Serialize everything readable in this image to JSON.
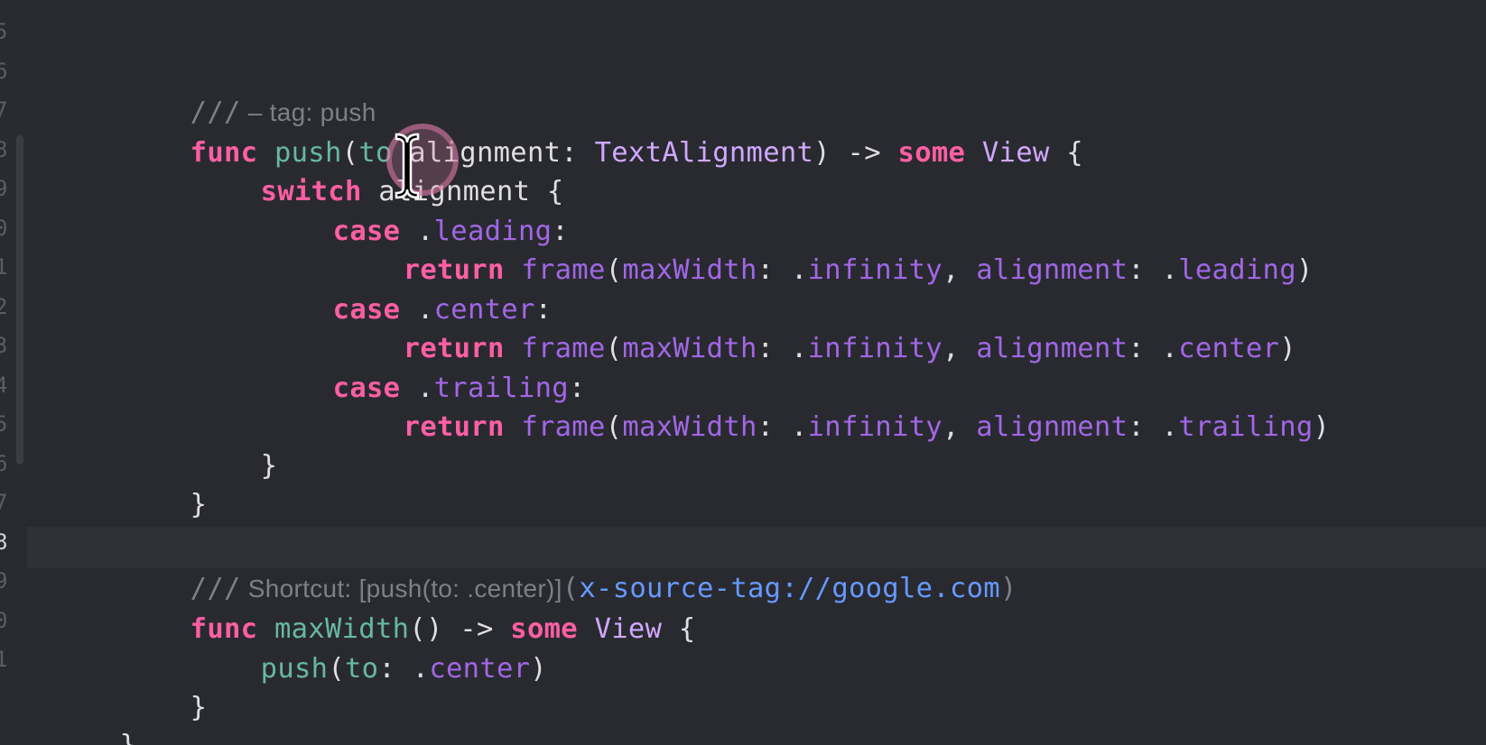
{
  "gutter": {
    "numbers": [
      "5",
      "6",
      "7",
      "8",
      "9",
      "0",
      "1",
      "2",
      "3",
      "4",
      "5",
      "6",
      "7",
      "8",
      "9",
      "0",
      "1"
    ],
    "current_index": 13
  },
  "code": {
    "line1": {
      "comment_slashes": "///",
      "comment_text": " – tag: push"
    },
    "line2": {
      "kw_func": "func",
      "name": "push",
      "open": "(",
      "label_to": "to",
      "param": " alignment: ",
      "type": "TextAlignment",
      "close": ") -> ",
      "kw_some": "some",
      "view": "View",
      "brace": " {"
    },
    "line3": {
      "kw_switch": "switch",
      "subject": " alignment {"
    },
    "line4": {
      "kw_case": "case",
      "dot": " .",
      "member": "leading",
      "colon": ":"
    },
    "line5": {
      "kw_return": "return",
      "fn": "frame",
      "open": "(",
      "arg1": "maxWidth",
      "sep1": ": .",
      "val1": "infinity",
      "comma": ", ",
      "arg2": "alignment",
      "sep2": ": .",
      "val2": "leading",
      "close": ")"
    },
    "line6": {
      "kw_case": "case",
      "dot": " .",
      "member": "center",
      "colon": ":"
    },
    "line7": {
      "kw_return": "return",
      "fn": "frame",
      "open": "(",
      "arg1": "maxWidth",
      "sep1": ": .",
      "val1": "infinity",
      "comma": ", ",
      "arg2": "alignment",
      "sep2": ": .",
      "val2": "center",
      "close": ")"
    },
    "line8": {
      "kw_case": "case",
      "dot": " .",
      "member": "trailing",
      "colon": ":"
    },
    "line9": {
      "kw_return": "return",
      "fn": "frame",
      "open": "(",
      "arg1": "maxWidth",
      "sep1": ": .",
      "val1": "infinity",
      "comma": ", ",
      "arg2": "alignment",
      "sep2": ": .",
      "val2": "trailing",
      "close": ")"
    },
    "line10": {
      "brace": "}"
    },
    "line11": {
      "brace": "}"
    },
    "line12": {
      "comment_slashes": "///",
      "doc_text": " Shortcut: [push(to: .center)]",
      "paren_open": "(",
      "link": "x-source-tag://google.com",
      "paren_close": ")"
    },
    "line13": {
      "kw_func": "func",
      "name": "maxWidth",
      "sig": "() -> ",
      "kw_some": "some",
      "view": "View",
      "brace": " {"
    },
    "line14": {
      "fn": "push",
      "open": "(",
      "label_to": "to",
      "sep": ": .",
      "member": "center",
      "close": ")"
    },
    "line15": {
      "brace": "}"
    },
    "line16": {
      "brace": "}"
    }
  }
}
